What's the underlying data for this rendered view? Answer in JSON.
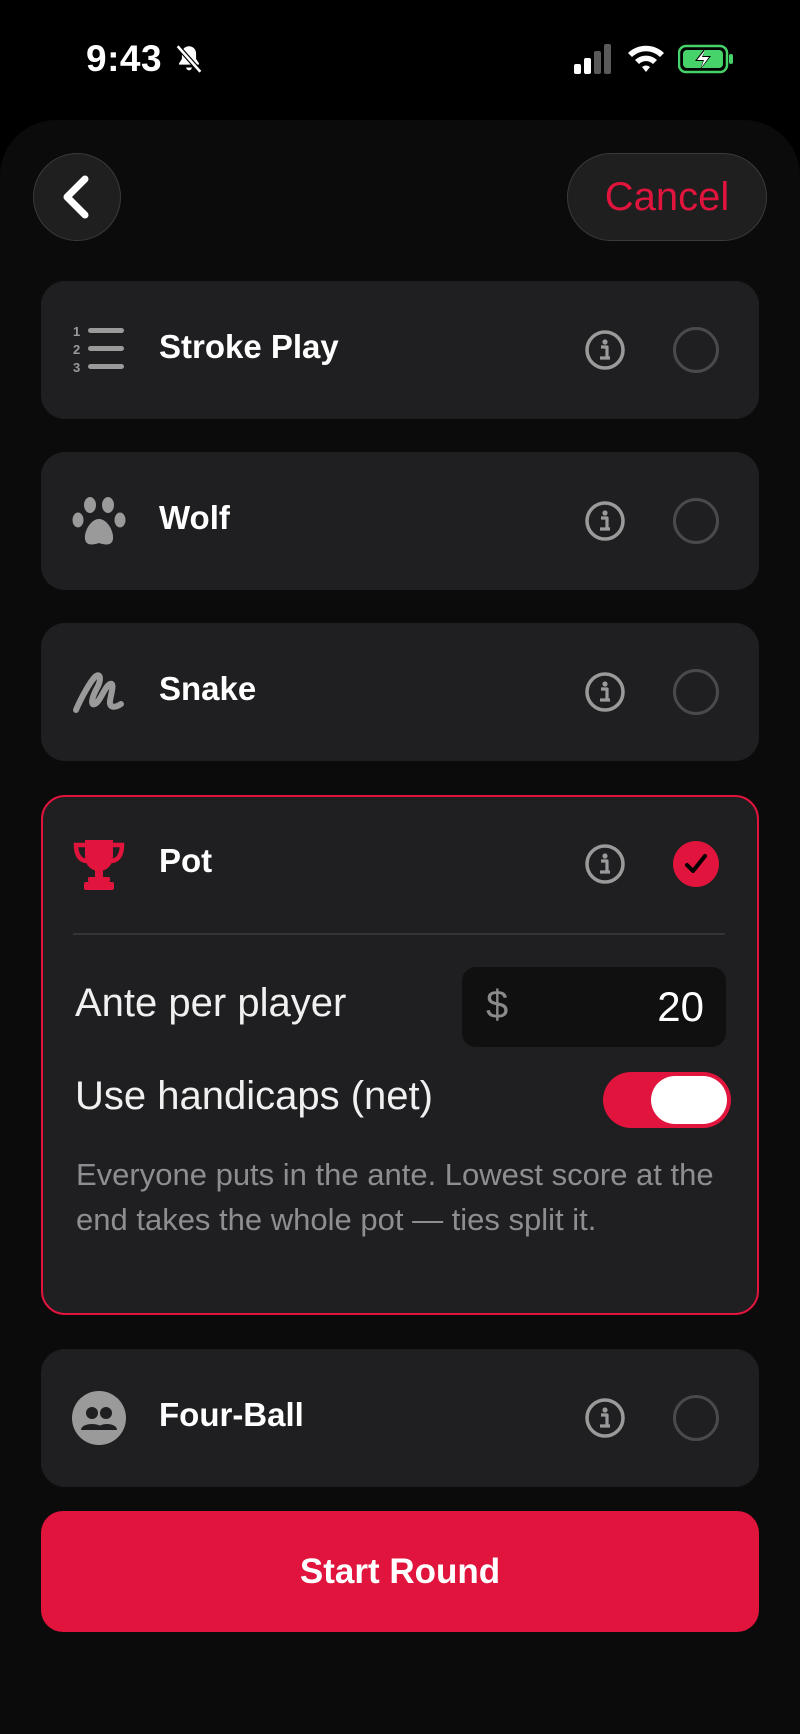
{
  "status_bar": {
    "time": "9:43",
    "icons": [
      "bell-slash-icon",
      "cellular-signal-icon",
      "wifi-icon",
      "battery-charging-icon"
    ]
  },
  "header": {
    "back_icon": "chevron-left-icon",
    "cancel_label": "Cancel"
  },
  "games": [
    {
      "title": "Stroke Play",
      "icon": "numbered-list-icon",
      "selected": false
    },
    {
      "title": "Wolf",
      "icon": "paw-icon",
      "selected": false
    },
    {
      "title": "Snake",
      "icon": "squiggle-icon",
      "selected": false
    },
    {
      "title": "Pot",
      "icon": "trophy-icon",
      "selected": true
    },
    {
      "title": "Four-Ball",
      "icon": "people-icon",
      "selected": false
    }
  ],
  "pot_options": {
    "ante_label": "Ante per player",
    "currency": "$",
    "ante_value": "20",
    "handicap_label": "Use handicaps (net)",
    "handicap_enabled": true,
    "description": "Everyone puts in the ante. Lowest score at the end takes the whole pot — ties split it."
  },
  "footer": {
    "start_label": "Start Round"
  },
  "colors": {
    "accent": "#e0143c",
    "card": "#1f1f21",
    "background": "#000000"
  }
}
